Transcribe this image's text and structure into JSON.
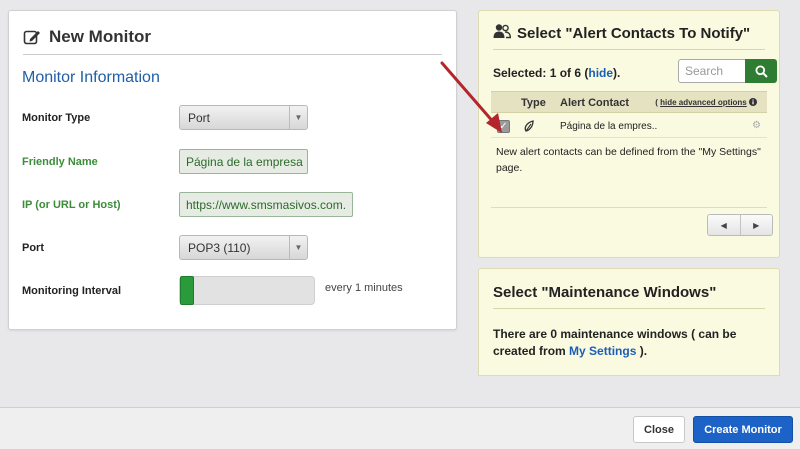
{
  "left_panel": {
    "title": "New Monitor",
    "section_title": "Monitor Information",
    "fields": {
      "monitor_type": {
        "label": "Monitor Type",
        "value": "Port"
      },
      "friendly_name": {
        "label": "Friendly Name",
        "value": "Página de la empresa"
      },
      "ip": {
        "label": "IP (or URL or Host)",
        "value": "https://www.smsmasivos.com."
      },
      "port": {
        "label": "Port",
        "value": "POP3 (110)"
      },
      "interval": {
        "label": "Monitoring Interval",
        "value_text": "every 1 minutes",
        "slider_level": 0.0
      }
    }
  },
  "alert_contacts": {
    "title": "Select \"Alert Contacts To Notify\"",
    "selected_prefix": "Selected: 1 of 6 (",
    "hide_link": "hide",
    "selected_suffix": ").",
    "search_placeholder": "Search",
    "columns": {
      "type": "Type",
      "contact": "Alert Contact",
      "advanced_prefix": "( ",
      "advanced_link": "hide advanced options",
      "advanced_suffix": " "
    },
    "rows": [
      {
        "checked": true,
        "contact": "Página de la empres.."
      }
    ],
    "note": "New alert contacts can be defined from the \"My Settings\" page."
  },
  "maintenance": {
    "title": "Select \"Maintenance Windows\"",
    "text_prefix": "There are 0 maintenance windows ( can be created from ",
    "link": "My Settings",
    "text_suffix": " )."
  },
  "footer": {
    "close_label": "Close",
    "create_label": "Create Monitor"
  },
  "colors": {
    "accent_blue": "#1d62c7",
    "green": "#2e7d32",
    "panel_yellow": "#fafae1",
    "arrow_red": "#b3262c"
  }
}
